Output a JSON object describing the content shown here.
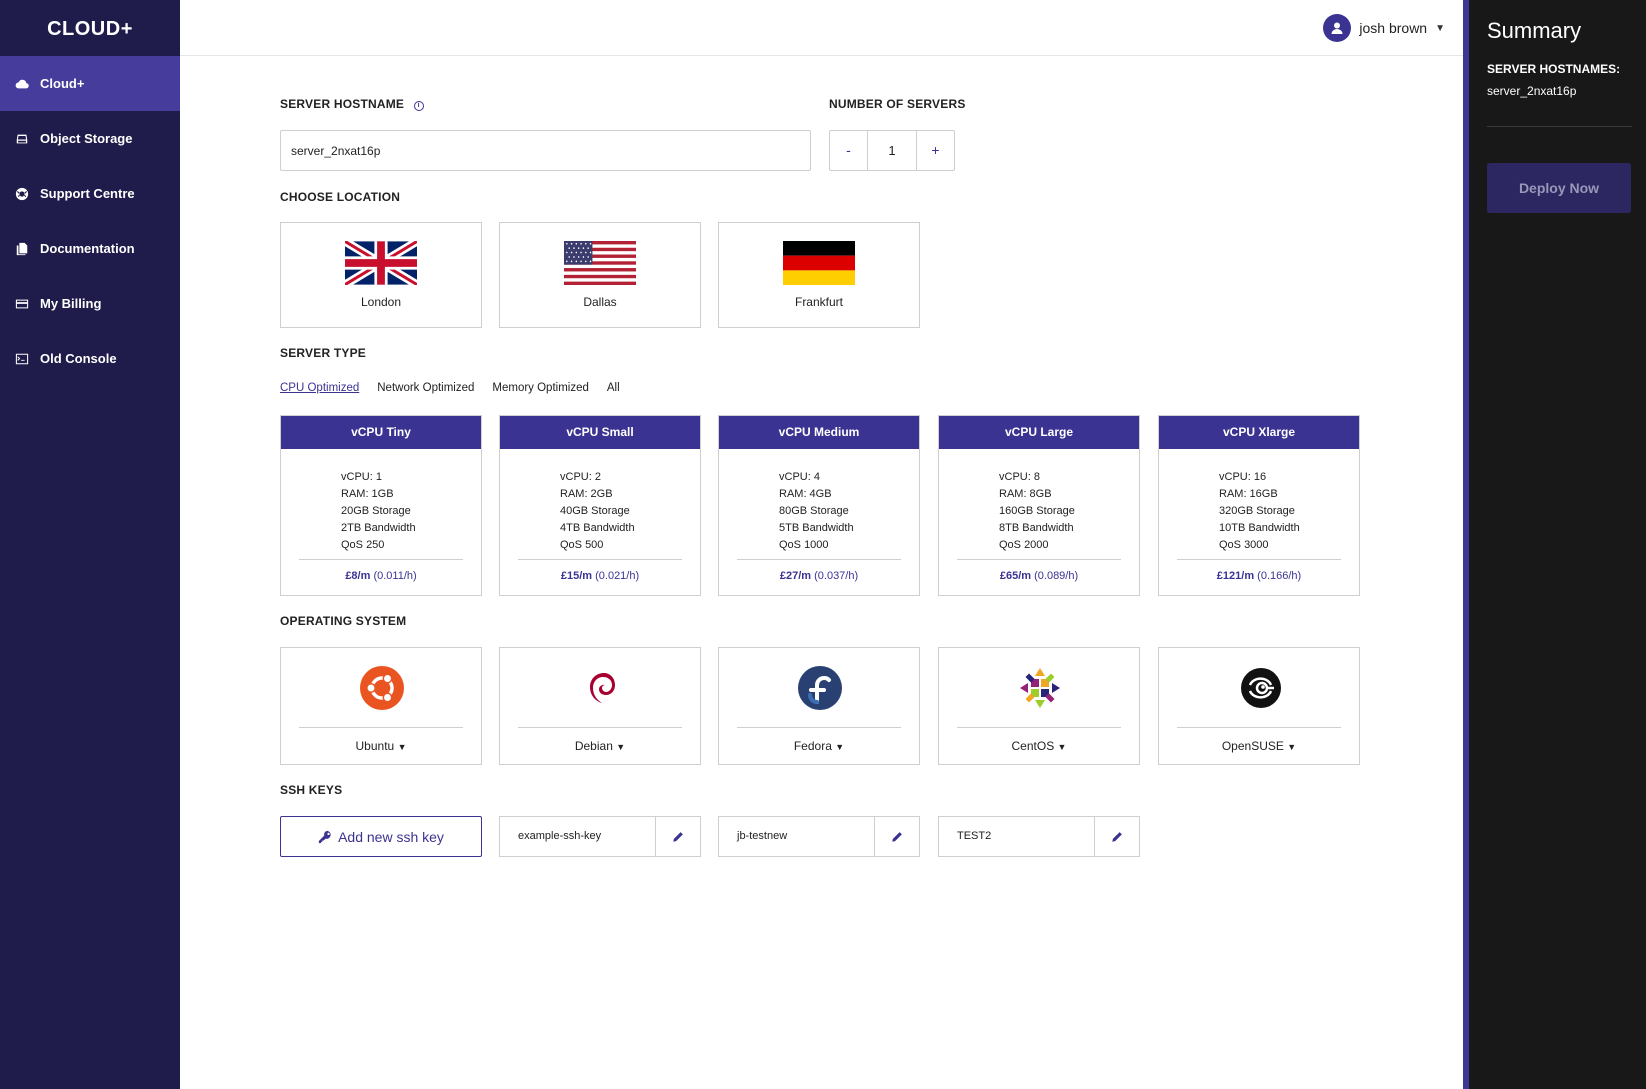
{
  "app": {
    "brand": "CLOUD+"
  },
  "sidebar": {
    "items": [
      {
        "label": "Cloud+",
        "icon": "cloud-icon",
        "active": true
      },
      {
        "label": "Object Storage",
        "icon": "storage-icon"
      },
      {
        "label": "Support Centre",
        "icon": "lifebuoy-icon"
      },
      {
        "label": "Documentation",
        "icon": "documents-icon"
      },
      {
        "label": "My Billing",
        "icon": "credit-card-icon"
      },
      {
        "label": "Old Console",
        "icon": "terminal-icon"
      }
    ]
  },
  "header": {
    "user_name": "josh brown"
  },
  "form": {
    "hostname_label": "SERVER HOSTNAME",
    "hostname_value": "server_2nxat16p",
    "count_label": "NUMBER OF SERVERS",
    "count_minus": "-",
    "count_value": "1",
    "count_plus": "+",
    "location_label": "CHOOSE LOCATION",
    "locations": [
      "London",
      "Dallas",
      "Frankfurt"
    ],
    "server_type_label": "SERVER TYPE",
    "tabs": [
      "CPU Optimized",
      "Network Optimized",
      "Memory Optimized",
      "All"
    ],
    "server_types": [
      {
        "name": "vCPU Tiny",
        "specs": [
          "vCPU: 1",
          "RAM: 1GB",
          "20GB Storage",
          "2TB Bandwidth",
          "QoS 250"
        ],
        "price_monthly": "£8/m",
        "price_hourly": "(0.011/h)"
      },
      {
        "name": "vCPU Small",
        "specs": [
          "vCPU: 2",
          "RAM: 2GB",
          "40GB Storage",
          "4TB Bandwidth",
          "QoS 500"
        ],
        "price_monthly": "£15/m",
        "price_hourly": "(0.021/h)"
      },
      {
        "name": "vCPU Medium",
        "specs": [
          "vCPU: 4",
          "RAM: 4GB",
          "80GB Storage",
          "5TB Bandwidth",
          "QoS 1000"
        ],
        "price_monthly": "£27/m",
        "price_hourly": "(0.037/h)"
      },
      {
        "name": "vCPU Large",
        "specs": [
          "vCPU: 8",
          "RAM: 8GB",
          "160GB Storage",
          "8TB Bandwidth",
          "QoS 2000"
        ],
        "price_monthly": "£65/m",
        "price_hourly": "(0.089/h)"
      },
      {
        "name": "vCPU Xlarge",
        "specs": [
          "vCPU: 16",
          "RAM: 16GB",
          "320GB Storage",
          "10TB Bandwidth",
          "QoS 3000"
        ],
        "price_monthly": "£121/m",
        "price_hourly": "(0.166/h)"
      }
    ],
    "os_label": "OPERATING SYSTEM",
    "os": [
      "Ubuntu",
      "Debian",
      "Fedora",
      "CentOS",
      "OpenSUSE"
    ],
    "ssh_label": "SSH KEYS",
    "add_key_label": "Add new ssh key",
    "ssh_keys": [
      "example-ssh-key",
      "jb-testnew",
      "TEST2"
    ]
  },
  "summary": {
    "title": "Summary",
    "hostnames_label": "SERVER HOSTNAMES:",
    "hostnames_value": "server_2nxat16p",
    "deploy_label": "Deploy Now"
  },
  "colors": {
    "sidebar_bg": "#1f1b4a",
    "accent": "#3b3392",
    "active_nav": "#463c9c",
    "summary_bg": "#181818"
  }
}
